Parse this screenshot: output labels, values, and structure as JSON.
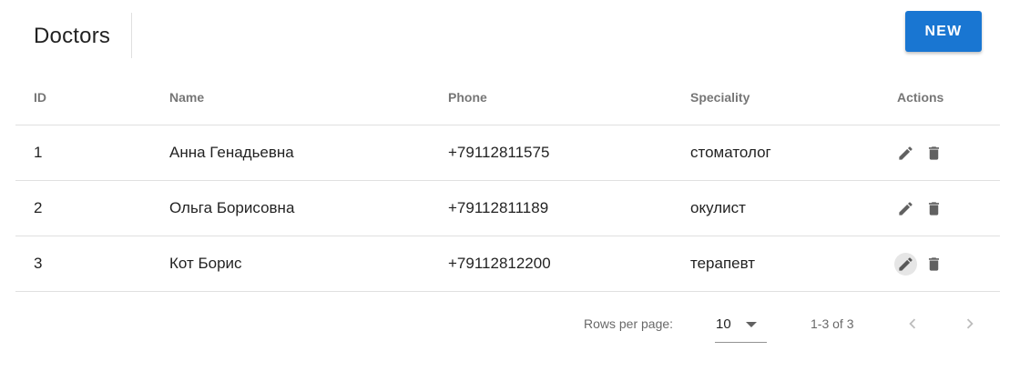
{
  "toolbar": {
    "title": "Doctors",
    "new_label": "NEW"
  },
  "table": {
    "headers": {
      "id": "ID",
      "name": "Name",
      "phone": "Phone",
      "speciality": "Speciality",
      "actions": "Actions"
    },
    "rows": [
      {
        "id": "1",
        "name": "Анна Генадьевна",
        "phone": "+79112811575",
        "speciality": "стоматолог"
      },
      {
        "id": "2",
        "name": "Ольга Борисовна",
        "phone": "+79112811189",
        "speciality": "окулист"
      },
      {
        "id": "3",
        "name": "Кот Борис",
        "phone": "+79112812200",
        "speciality": "терапевт"
      }
    ],
    "row_actions": [
      "edit-icon",
      "delete-icon"
    ]
  },
  "pagination": {
    "rows_per_page_label": "Rows per page:",
    "rows_per_page_value": "10",
    "range": "1-3 of 3"
  },
  "colors": {
    "primary": "#1976d2",
    "divider": "#e0e0e0"
  }
}
